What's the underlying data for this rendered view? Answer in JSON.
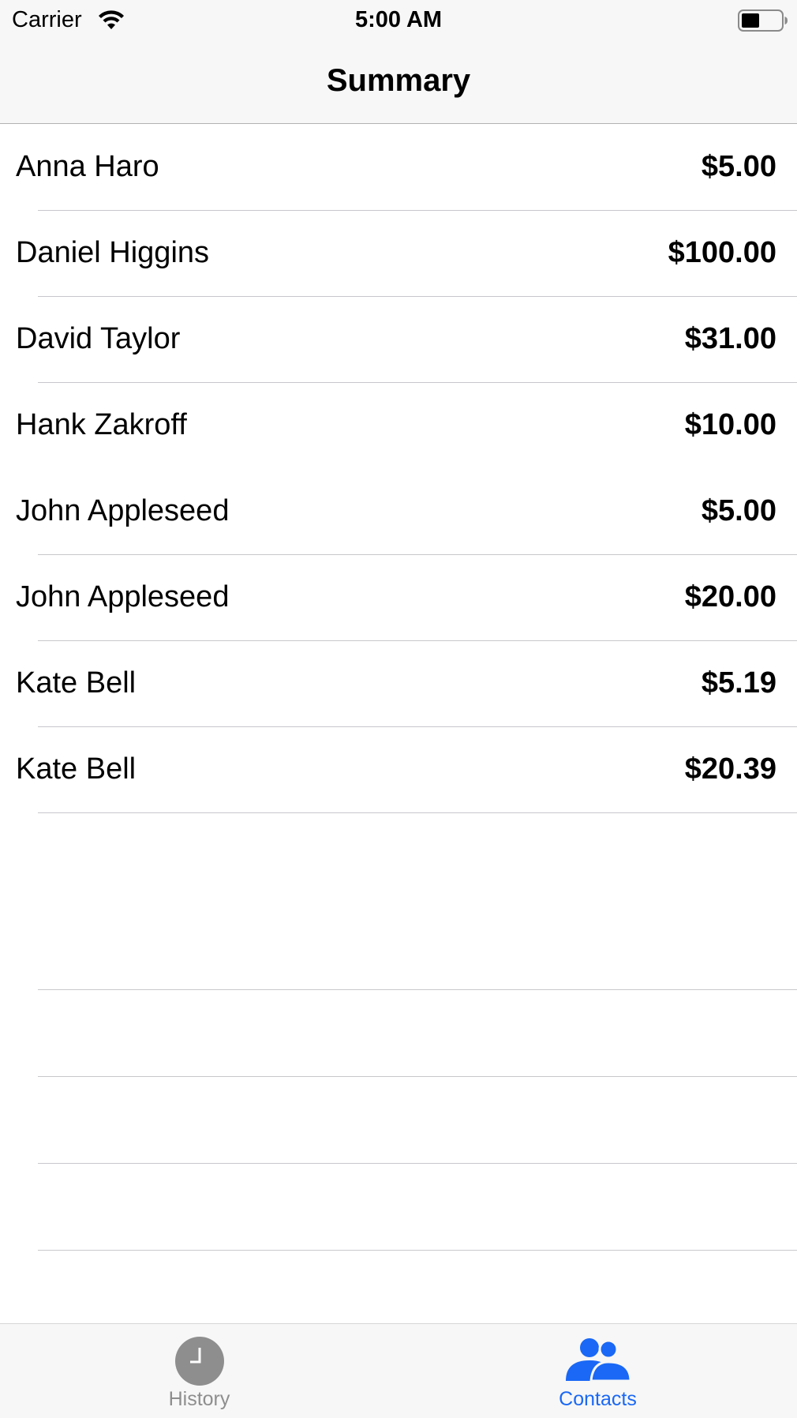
{
  "status_bar": {
    "carrier": "Carrier",
    "time": "5:00 AM"
  },
  "nav": {
    "title": "Summary"
  },
  "rows": [
    {
      "name": "Anna Haro",
      "amount": "$5.00"
    },
    {
      "name": "Daniel Higgins",
      "amount": "$100.00"
    },
    {
      "name": "David Taylor",
      "amount": "$31.00"
    },
    {
      "name": "Hank Zakroff",
      "amount": "$10.00"
    },
    {
      "name": "John Appleseed",
      "amount": "$5.00"
    },
    {
      "name": "John Appleseed",
      "amount": "$20.00"
    },
    {
      "name": "Kate Bell",
      "amount": "$5.19"
    },
    {
      "name": "Kate Bell",
      "amount": "$20.39"
    }
  ],
  "tabs": [
    {
      "label": "History",
      "icon": "clock-icon",
      "selected": false
    },
    {
      "label": "Contacts",
      "icon": "contacts-icon",
      "selected": true
    }
  ],
  "colors": {
    "accent": "#1a68f5",
    "inactive": "#8e8e8e",
    "bar_background": "#f7f7f7",
    "separator": "#c8c7cc"
  }
}
